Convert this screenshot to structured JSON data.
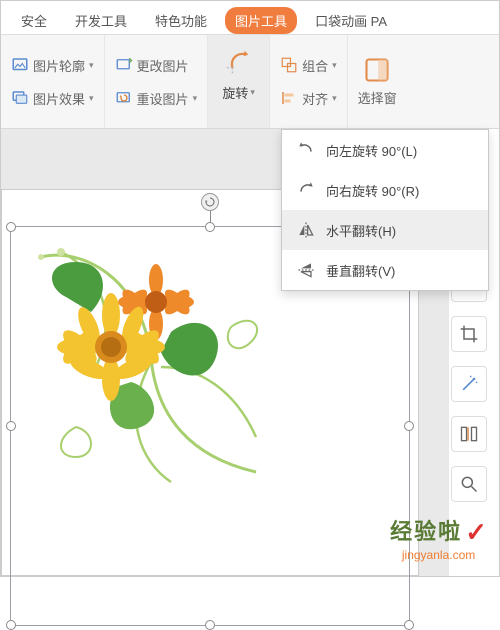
{
  "tabs": {
    "security": "安全",
    "devtools": "开发工具",
    "features": "特色功能",
    "picture_tools": "图片工具",
    "pocket_anim": "口袋动画 PA"
  },
  "ribbon": {
    "outline": "图片轮廓",
    "change": "更改图片",
    "effects": "图片效果",
    "reset": "重设图片",
    "rotate": "旋转",
    "group": "组合",
    "align": "对齐",
    "select_pane": "选择窗"
  },
  "menu": {
    "rotate_left": "向左旋转 90°(L)",
    "rotate_right": "向右旋转 90°(R)",
    "flip_h": "水平翻转(H)",
    "flip_v": "垂直翻转(V)"
  },
  "watermark": {
    "title": "经验啦",
    "url": "jingyanla.com"
  },
  "colors": {
    "accent": "#f07c3e",
    "highlight": "#ececec"
  }
}
